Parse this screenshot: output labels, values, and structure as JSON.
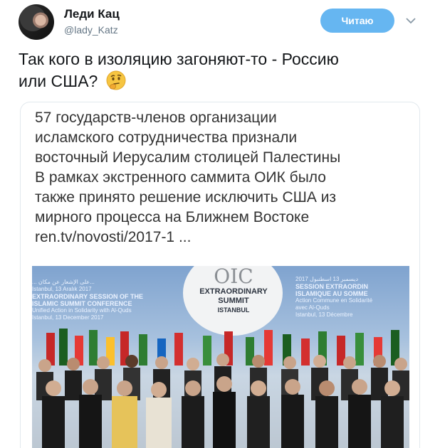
{
  "author": {
    "name": "Леди Кац",
    "handle": "@lady_Katz",
    "avatar_icon": "avatar"
  },
  "follow_button": {
    "label": "Читаю",
    "color": "#66b6f1"
  },
  "caret_icon": "chevron-down-icon",
  "tweet": {
    "text_line1": "Так кого в изоляцию загоняют-то - Россию",
    "text_line2": "или США?",
    "emoji": "thinking-face-emoji"
  },
  "card": {
    "lines": [
      "57 государств-членов организации",
      "исламского сотрудничества признали",
      "восточный Иерусалим столицей Палестины",
      "В рамках экстренного саммита ОИК было",
      "также принято решение исключить США из",
      "мирного процесса на Ближнем Востоке"
    ],
    "link": "ren.tv/novosti/2017-1   ...",
    "photo": {
      "banner_left": [
        "... على الإشعار عن مكان...",
        "Istanbul, 13 Aralık 2017",
        "EXTRAORDINARY SESSION OF THE",
        "ISLAMIC SUMMIT CONFERENCE",
        "Unified Action in Solidarity with Al-Quds",
        "Istanbul, 13 December 2017"
      ],
      "oic_logo": "OIC",
      "summit_lines": [
        "EXTRAORDINARY",
        "SUMMIT",
        "ISTANBUL"
      ],
      "banner_right": [
        "2017 ديسمبر 13 اسطنبول",
        "SESSION EXTRAORDIN",
        "ISLAMIQUE AU SOMME",
        "Action Commune en Solidarité",
        "avec Al-Quds",
        "Istanbul, 13 Décembre"
      ]
    }
  }
}
